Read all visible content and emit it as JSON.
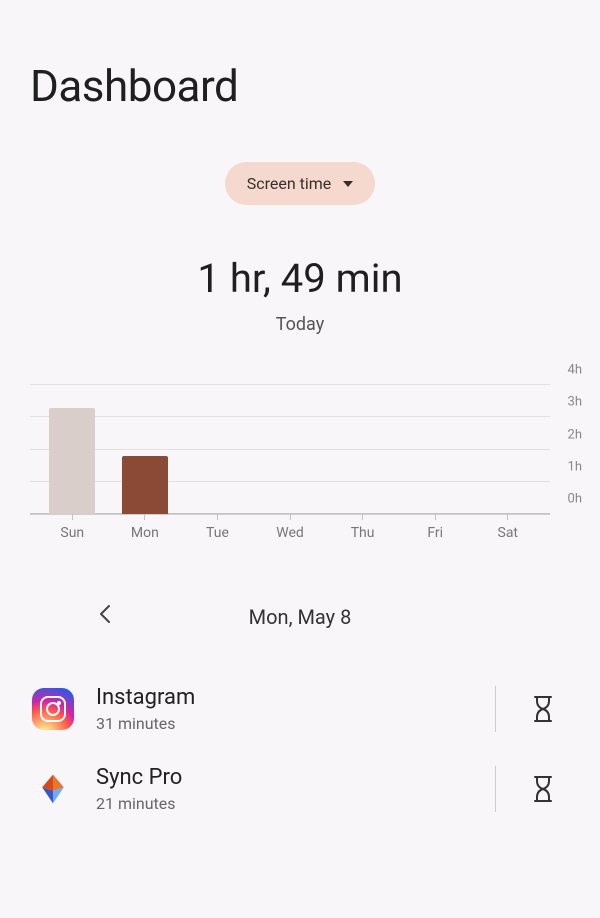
{
  "title": "Dashboard",
  "dropdown": {
    "label": "Screen time"
  },
  "summary": {
    "value": "1 hr, 49 min",
    "caption": "Today"
  },
  "date_nav": {
    "label": "Mon, May 8"
  },
  "apps": [
    {
      "name": "Instagram",
      "time": "31 minutes"
    },
    {
      "name": "Sync Pro",
      "time": "21 minutes"
    }
  ],
  "chart_data": {
    "type": "bar",
    "categories": [
      "Sun",
      "Mon",
      "Tue",
      "Wed",
      "Thu",
      "Fri",
      "Sat"
    ],
    "values": [
      3.3,
      1.8,
      0,
      0,
      0,
      0,
      0
    ],
    "yticks": [
      0,
      1,
      2,
      3,
      4
    ],
    "yticklabels": [
      "0h",
      "1h",
      "2h",
      "3h",
      "4h"
    ],
    "ylim": [
      0,
      4
    ],
    "colors": [
      "#d9cec9",
      "#8a4a36",
      "#d9cec9",
      "#d9cec9",
      "#d9cec9",
      "#d9cec9",
      "#d9cec9"
    ],
    "title": "",
    "xlabel": "",
    "ylabel": ""
  }
}
